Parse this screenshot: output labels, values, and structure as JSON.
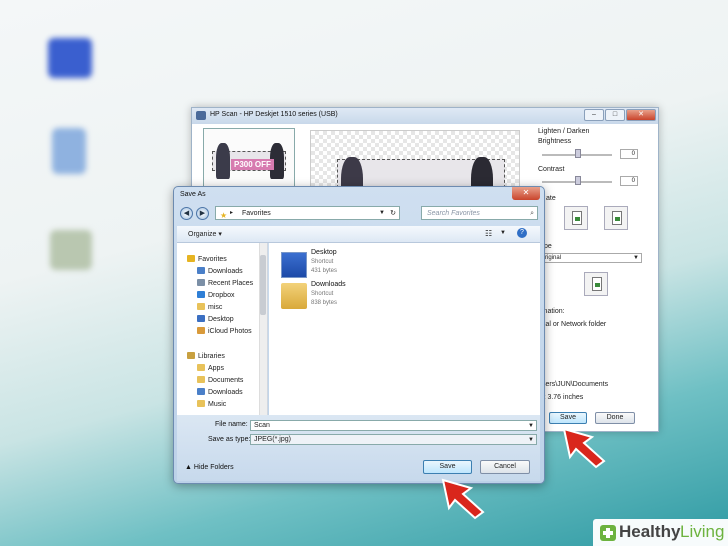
{
  "hp_window": {
    "title": "HP Scan - HP Deskjet 1510 series (USB)",
    "thumb_promo": "P300 OFF",
    "lighten_darken": "Lighten / Darken",
    "brightness": "Brightness",
    "brightness_value": "0",
    "contrast": "Contrast",
    "contrast_value": "0",
    "rotate_label": "ate",
    "type_label": "pe",
    "type_value": "riginal",
    "destination_label": "ination:",
    "destination_value": "cal or Network folder",
    "path_text": "sers\\JUN\\Documents",
    "size_text": "x 3.76 inches",
    "save_button": "Save",
    "done_button": "Done"
  },
  "save_dialog": {
    "title": "Save As",
    "address": "Favorites",
    "search_placeholder": "Search Favorites",
    "organize": "Organize",
    "nav_items": [
      {
        "label": "Favorites",
        "color": "#e6b422"
      },
      {
        "label": "Downloads",
        "color": "#4a7fc8"
      },
      {
        "label": "Recent Places",
        "color": "#7b8fa6"
      },
      {
        "label": "Dropbox",
        "color": "#2f7fd6"
      },
      {
        "label": "misc",
        "color": "#e8c25a"
      },
      {
        "label": "Desktop",
        "color": "#3b6fc2"
      },
      {
        "label": "iCloud Photos",
        "color": "#d99a3a"
      },
      {
        "label": "Libraries",
        "color": "#c8a040"
      },
      {
        "label": "Apps",
        "color": "#e8c25a"
      },
      {
        "label": "Documents",
        "color": "#e8c25a"
      },
      {
        "label": "Downloads",
        "color": "#4a7fc8"
      },
      {
        "label": "Music",
        "color": "#e8c25a"
      }
    ],
    "files": [
      {
        "name": "Desktop",
        "type": "Shortcut",
        "size": "431 bytes"
      },
      {
        "name": "Downloads",
        "type": "Shortcut",
        "size": "838 bytes"
      }
    ],
    "file_name_label": "File name:",
    "file_name_value": "Scan",
    "save_as_type_label": "Save as type:",
    "save_as_type_value": "JPEG(*.jpg)",
    "hide_folders": "Hide Folders",
    "save_button": "Save",
    "cancel_button": "Cancel"
  },
  "watermark": {
    "part1": "Healthy",
    "part2": "Living"
  },
  "colors": {
    "arrow_red": "#d9261c",
    "brand_green": "#6db33f"
  }
}
